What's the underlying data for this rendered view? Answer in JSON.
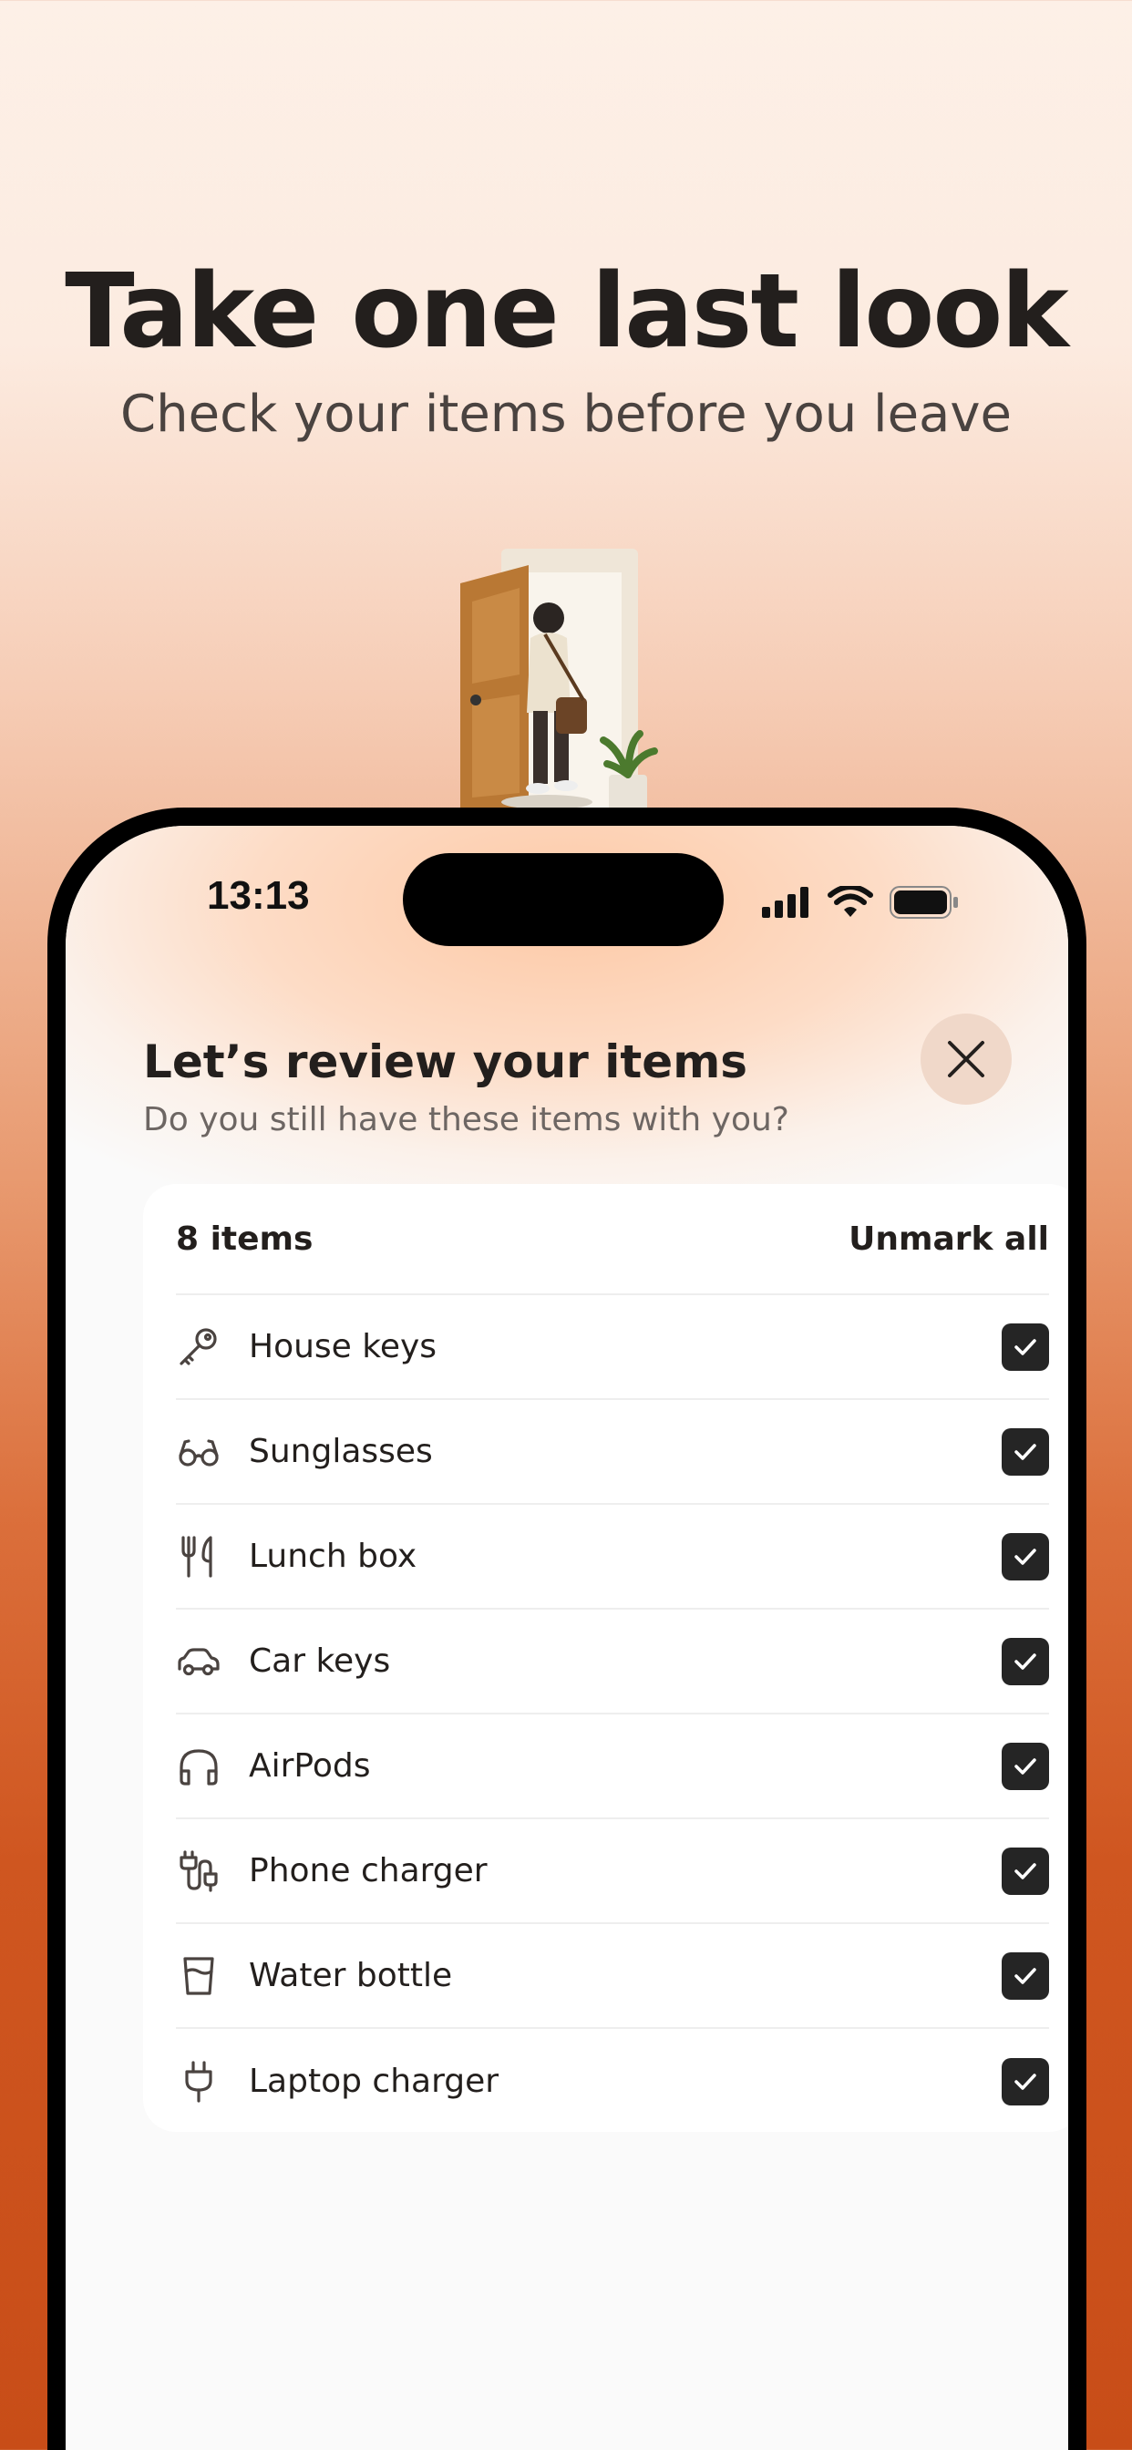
{
  "hero": {
    "title": "Take one last look",
    "subtitle": "Check your items before you leave"
  },
  "status_bar": {
    "time": "13:13"
  },
  "sheet": {
    "title": "Let’s review your items",
    "subtitle": "Do you still have these items with you?",
    "close_icon": "close-icon"
  },
  "card": {
    "count_label": "8 items",
    "unmark_label": "Unmark all",
    "items": [
      {
        "label": "House keys",
        "icon": "key-icon",
        "checked": true
      },
      {
        "label": "Sunglasses",
        "icon": "glasses-icon",
        "checked": true
      },
      {
        "label": "Lunch box",
        "icon": "utensils-icon",
        "checked": true
      },
      {
        "label": "Car keys",
        "icon": "car-icon",
        "checked": true
      },
      {
        "label": "AirPods",
        "icon": "headphones-icon",
        "checked": true
      },
      {
        "label": "Phone charger",
        "icon": "cable-icon",
        "checked": true
      },
      {
        "label": "Water bottle",
        "icon": "cup-icon",
        "checked": true
      },
      {
        "label": "Laptop charger",
        "icon": "plug-icon",
        "checked": true
      }
    ]
  },
  "colors": {
    "accent": "#cf5620",
    "checkbox": "#252525",
    "text": "#231f1d"
  }
}
